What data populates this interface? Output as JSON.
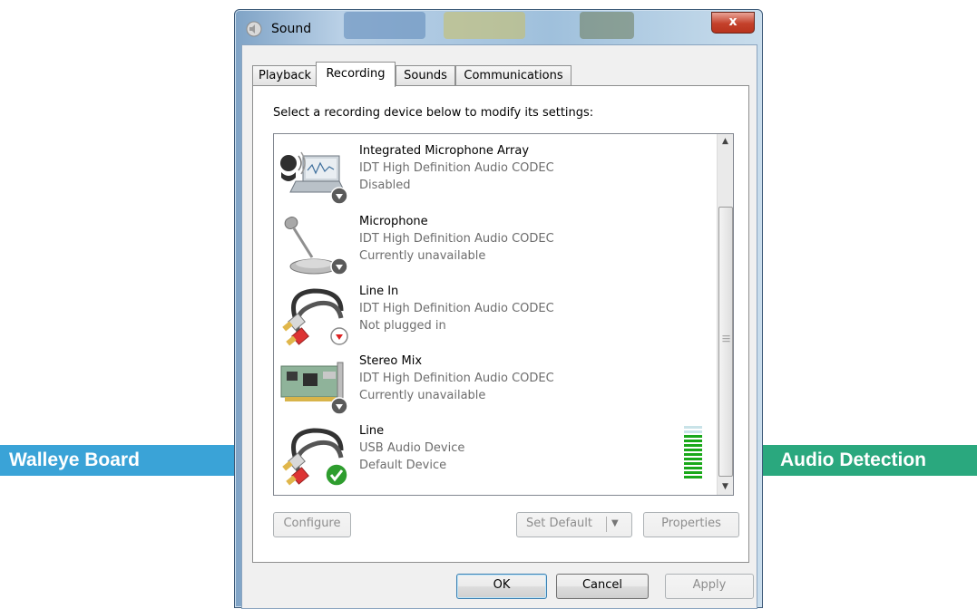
{
  "window": {
    "title": "Sound",
    "close_label": "x"
  },
  "tabs": [
    {
      "label": "Playback"
    },
    {
      "label": "Recording"
    },
    {
      "label": "Sounds"
    },
    {
      "label": "Communications"
    }
  ],
  "instruction": "Select a recording device below to modify its settings:",
  "devices": [
    {
      "name": "Integrated Microphone Array",
      "description": "IDT High Definition Audio CODEC",
      "status": "Disabled",
      "icon": "laptop-microphone-icon",
      "badge": "down-arrow-badge-icon"
    },
    {
      "name": "Microphone",
      "description": "IDT High Definition Audio CODEC",
      "status": "Currently unavailable",
      "icon": "desk-microphone-icon",
      "badge": "down-arrow-badge-icon"
    },
    {
      "name": "Line In",
      "description": "IDT High Definition Audio CODEC",
      "status": "Not plugged in",
      "icon": "rca-cable-icon",
      "badge": "red-down-arrow-badge-icon"
    },
    {
      "name": "Stereo Mix",
      "description": "IDT High Definition Audio CODEC",
      "status": "Currently unavailable",
      "icon": "sound-card-icon",
      "badge": "down-arrow-badge-icon"
    },
    {
      "name": "Line",
      "description": "USB Audio Device",
      "status": "Default Device",
      "icon": "rca-cable-icon",
      "badge": "green-check-badge-icon"
    }
  ],
  "level_meter": {
    "level": 0.8
  },
  "buttons": {
    "configure": "Configure",
    "set_default": "Set Default",
    "properties": "Properties",
    "ok": "OK",
    "cancel": "Cancel",
    "apply": "Apply"
  },
  "callouts": {
    "left": "Walleye Board",
    "right": "Audio Detection"
  },
  "colors": {
    "callout_left": "#3aa3d7",
    "callout_right": "#2aa87e",
    "meter_green": "#1aa81a",
    "meter_off": "#c9e3e8",
    "check_green": "#2e9d2e"
  }
}
